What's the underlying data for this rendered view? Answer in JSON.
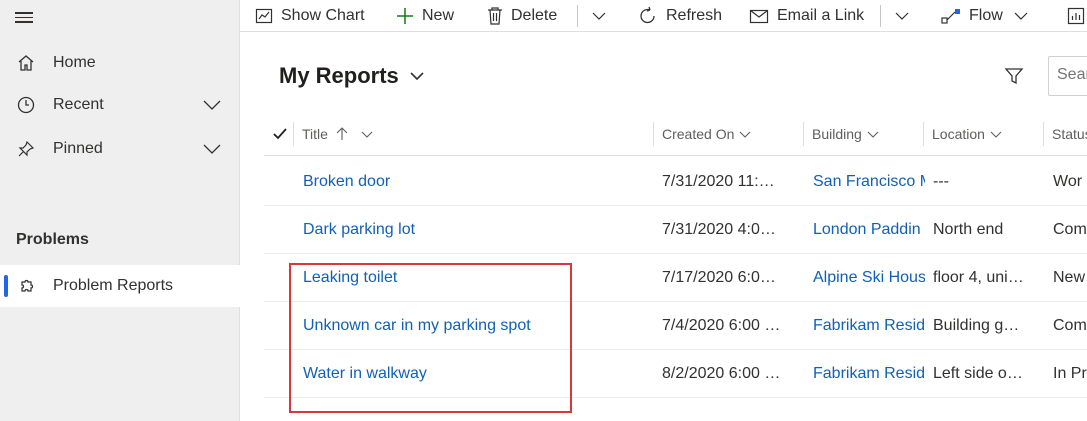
{
  "sidebar": {
    "items": [
      {
        "label": "Home",
        "icon": "home-icon"
      },
      {
        "label": "Recent",
        "icon": "clock-icon"
      },
      {
        "label": "Pinned",
        "icon": "pin-icon"
      }
    ],
    "section_title": "Problems",
    "active_item": {
      "label": "Problem Reports",
      "icon": "puzzle-icon"
    }
  },
  "commandbar": {
    "show_chart": "Show Chart",
    "new": "New",
    "delete": "Delete",
    "refresh": "Refresh",
    "email_link": "Email a Link",
    "flow": "Flow"
  },
  "view": {
    "title": "My Reports",
    "search_placeholder": "Search this view"
  },
  "grid": {
    "columns": [
      "Title",
      "Created On",
      "Building",
      "Location",
      "Status"
    ],
    "rows": [
      {
        "title": "Broken door",
        "created": "7/31/2020 11:…",
        "building": "San Francisco M",
        "location": "---",
        "status": "Wor"
      },
      {
        "title": "Dark parking lot",
        "created": "7/31/2020 4:0…",
        "building": "London Paddin",
        "location": "North end",
        "status": "Com"
      },
      {
        "title": "Leaking toilet",
        "created": "7/17/2020 6:0…",
        "building": "Alpine Ski Hous",
        "location": "floor 4, uni…",
        "status": "New"
      },
      {
        "title": "Unknown car in my parking spot",
        "created": "7/4/2020 6:00 …",
        "building": "Fabrikam Resid",
        "location": "Building g…",
        "status": "Com"
      },
      {
        "title": "Water in walkway",
        "created": "8/2/2020 6:00 …",
        "building": "Fabrikam Resid",
        "location": "Left side o…",
        "status": "In Pr"
      }
    ]
  },
  "colors": {
    "accent": "#2266e3",
    "link": "#1160b7",
    "highlight": "#d9383a"
  }
}
